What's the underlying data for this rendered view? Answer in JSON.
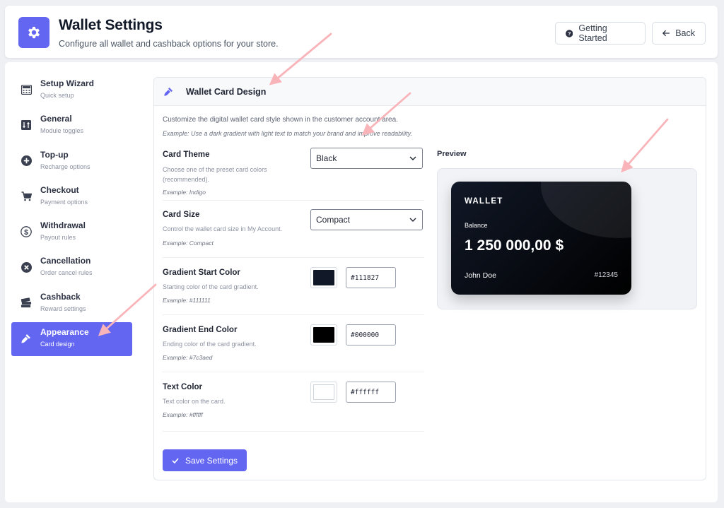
{
  "header": {
    "title": "Wallet Settings",
    "subtitle": "Configure all wallet and cashback options for your store.",
    "getting_started_label": "Getting Started",
    "back_label": "Back",
    "logo_icon": "gear-icon",
    "accent": "#6366f1"
  },
  "sidebar": {
    "items": [
      {
        "label": "Setup Wizard",
        "sub": "Quick setup",
        "icon": "calculator-icon",
        "active": false
      },
      {
        "label": "General",
        "sub": "Module toggles",
        "icon": "sliders-icon",
        "active": false
      },
      {
        "label": "Top-up",
        "sub": "Recharge options",
        "icon": "plus-circle-icon",
        "active": false
      },
      {
        "label": "Checkout",
        "sub": "Payment options",
        "icon": "cart-icon",
        "active": false
      },
      {
        "label": "Withdrawal",
        "sub": "Payout rules",
        "icon": "dollar-circle-icon",
        "active": false
      },
      {
        "label": "Cancellation",
        "sub": "Order cancel rules",
        "icon": "x-circle-icon",
        "active": false
      },
      {
        "label": "Cashback",
        "sub": "Reward settings",
        "icon": "money-stack-icon",
        "active": false
      },
      {
        "label": "Appearance",
        "sub": "Card design",
        "icon": "brush-icon",
        "active": true
      }
    ]
  },
  "panel": {
    "title": "Wallet Card Design",
    "description": "Customize the digital wallet card style shown in the customer account area.",
    "example": "Example: Use a dark gradient with light text to match your brand and improve readability.",
    "fields": {
      "card_theme": {
        "label": "Card Theme",
        "help": "Choose one of the preset card colors (recommended).",
        "example": "Example: Indigo",
        "value": "Black"
      },
      "card_size": {
        "label": "Card Size",
        "help": "Control the wallet card size in My Account.",
        "example": "Example: Compact",
        "value": "Compact"
      },
      "gradient_start": {
        "label": "Gradient Start Color",
        "help": "Starting color of the card gradient.",
        "example": "Example: #111111",
        "value": "#111827"
      },
      "gradient_end": {
        "label": "Gradient End Color",
        "help": "Ending color of the card gradient.",
        "example": "Example: #7c3aed",
        "value": "#000000"
      },
      "text_color": {
        "label": "Text Color",
        "help": "Text color on the card.",
        "example": "Example: #ffffff",
        "value": "#ffffff"
      }
    },
    "save_label": "Save Settings"
  },
  "preview": {
    "label": "Preview",
    "card": {
      "brand": "WALLET",
      "balance_label": "Balance",
      "amount": "1 250 000,00 $",
      "holder": "John Doe",
      "id": "#12345"
    }
  }
}
